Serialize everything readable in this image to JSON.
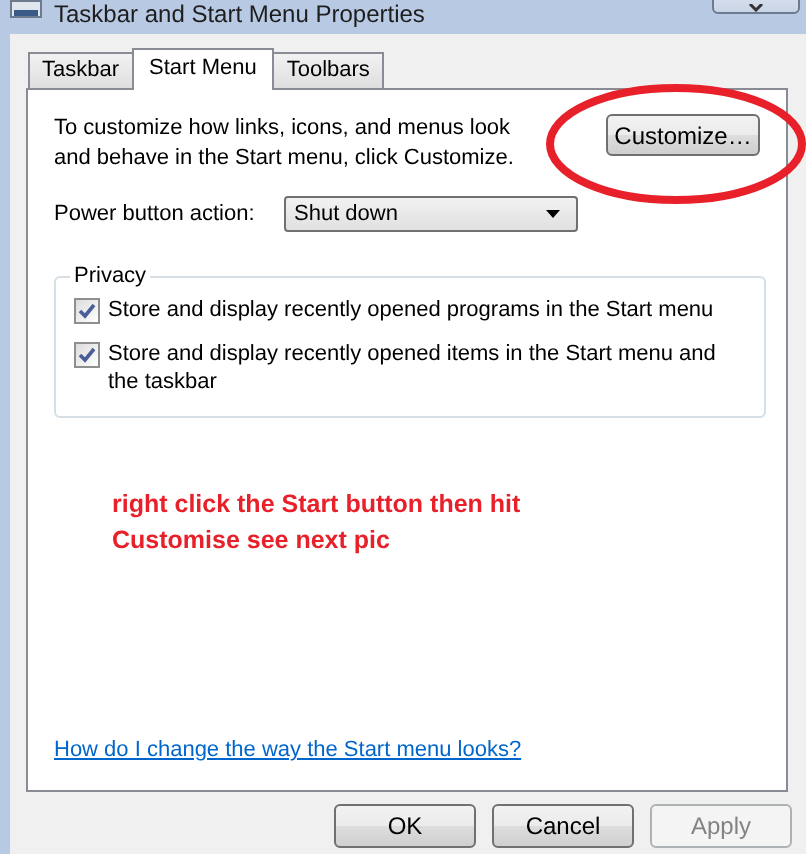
{
  "window": {
    "title": "Taskbar and Start Menu Properties"
  },
  "tabs": [
    {
      "label": "Taskbar",
      "selected": false
    },
    {
      "label": "Start Menu",
      "selected": true
    },
    {
      "label": "Toolbars",
      "selected": false
    }
  ],
  "intro": "To customize how links, icons, and menus look and behave in the Start menu, click Customize.",
  "customize_button": "Customize…",
  "power_button_action": {
    "label": "Power button action:",
    "value": "Shut down"
  },
  "privacy": {
    "title": "Privacy",
    "options": [
      {
        "label": "Store and display recently opened programs in the Start menu",
        "checked": true
      },
      {
        "label": "Store and display recently opened items in the Start menu and the taskbar",
        "checked": true
      }
    ]
  },
  "annotation": {
    "lines": [
      "right click the Start button then hit",
      "Customise see next pic"
    ]
  },
  "help_link": "How do I change the way the Start menu looks?",
  "buttons": [
    {
      "label": "OK",
      "disabled": false
    },
    {
      "label": "Cancel",
      "disabled": false
    },
    {
      "label": "Apply",
      "disabled": true
    }
  ]
}
